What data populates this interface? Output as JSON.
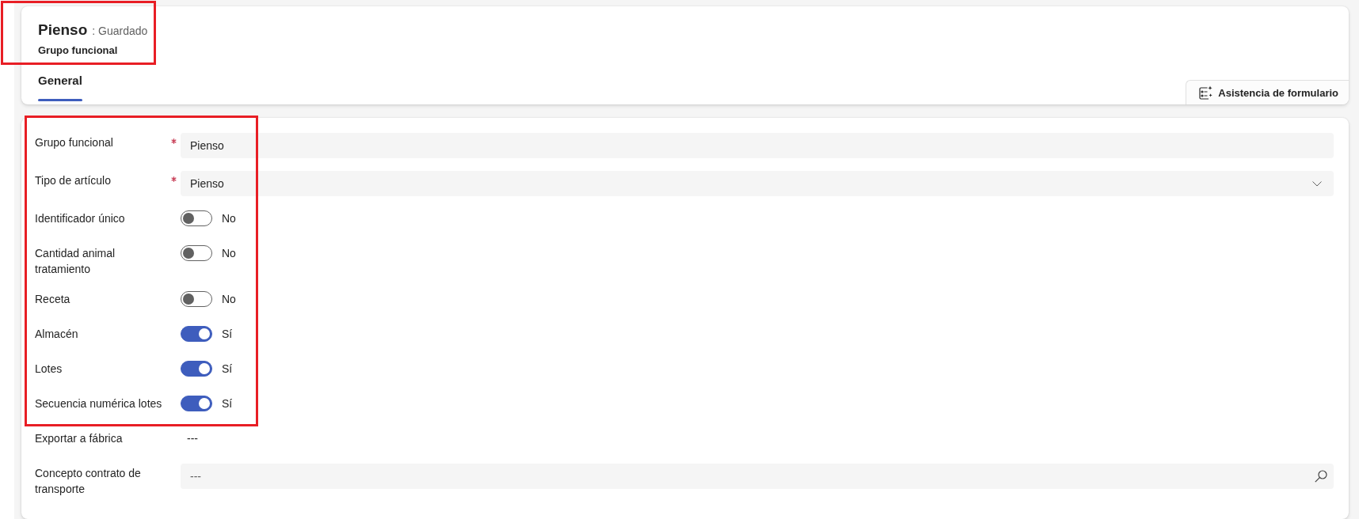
{
  "header": {
    "title": "Pienso",
    "status": ": Guardado",
    "subtitle": "Grupo funcional",
    "highlighted": true
  },
  "tabs": [
    {
      "label": "General",
      "selected": true
    }
  ],
  "command_button": {
    "label": "Asistencia de formulario"
  },
  "form": {
    "groups": [
      {
        "highlighted": true,
        "fields": [
          {
            "kind": "text",
            "label": "Grupo funcional",
            "required": true,
            "value": "Pienso"
          },
          {
            "kind": "select",
            "label": "Tipo de artículo",
            "required": true,
            "value": "Pienso"
          },
          {
            "kind": "toggle",
            "label": "Identificador único",
            "required": false,
            "on": false,
            "value": "No"
          },
          {
            "kind": "toggle",
            "label": "Cantidad animal tratamiento",
            "required": false,
            "on": false,
            "value": "No"
          },
          {
            "kind": "toggle",
            "label": "Receta",
            "required": false,
            "on": false,
            "value": "No"
          },
          {
            "kind": "toggle",
            "label": "Almacén",
            "required": false,
            "on": true,
            "value": "Sí"
          },
          {
            "kind": "toggle",
            "label": "Lotes",
            "required": false,
            "on": true,
            "value": "Sí"
          },
          {
            "kind": "toggle",
            "label": "Secuencia numérica lotes",
            "required": false,
            "on": true,
            "value": "Sí"
          }
        ]
      },
      {
        "highlighted": false,
        "fields": [
          {
            "kind": "readonly",
            "label": "Exportar a fábrica",
            "required": false,
            "value": "---"
          },
          {
            "kind": "lookup",
            "label": "Concepto contrato de transporte",
            "required": false,
            "placeholder": "---"
          }
        ]
      }
    ]
  }
}
